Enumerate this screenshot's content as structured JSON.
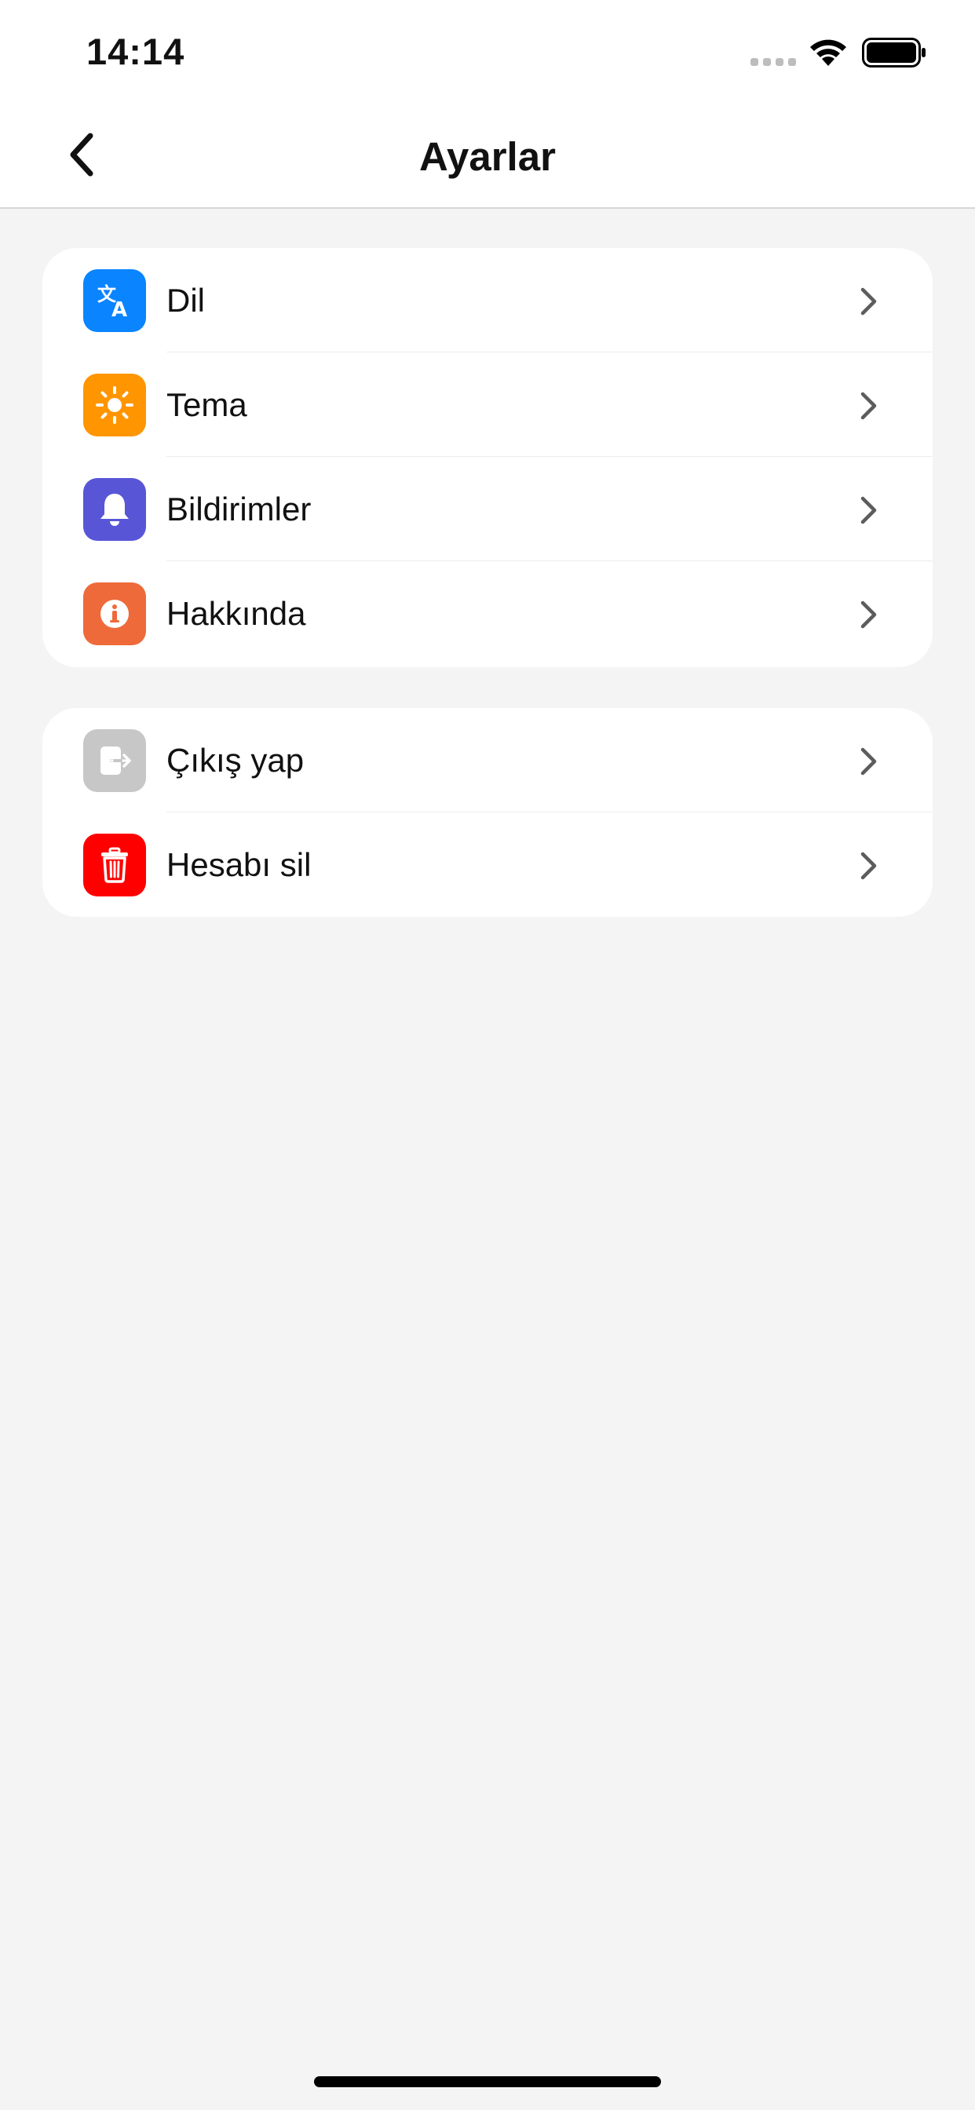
{
  "status_bar": {
    "time": "14:14"
  },
  "nav": {
    "title": "Ayarlar",
    "back_icon": "chevron-left-icon"
  },
  "groups": [
    {
      "items": [
        {
          "label": "Dil",
          "icon": "translate-icon",
          "color": "#0a84ff"
        },
        {
          "label": "Tema",
          "icon": "sun-icon",
          "color": "#ff9500"
        },
        {
          "label": "Bildirimler",
          "icon": "bell-icon",
          "color": "#5856d6"
        },
        {
          "label": "Hakkında",
          "icon": "info-icon",
          "color": "#ee6a3a"
        }
      ]
    },
    {
      "items": [
        {
          "label": "Çıkış yap",
          "icon": "logout-icon",
          "color": "#c7c7c7"
        },
        {
          "label": "Hesabı sil",
          "icon": "trash-icon",
          "color": "#ff0000"
        }
      ]
    }
  ]
}
